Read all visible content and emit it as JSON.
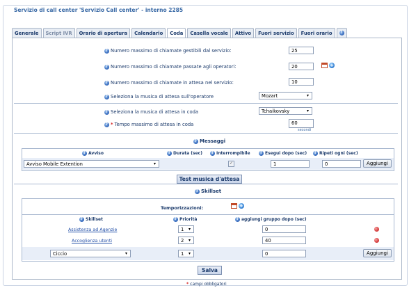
{
  "window": {
    "title": "Servizio di call center 'Servizio Call center' - interno 2285"
  },
  "tabs": [
    {
      "label": "Generale",
      "active": false
    },
    {
      "label": "Script IVR",
      "active": false
    },
    {
      "label": "Orario di apertura",
      "active": false
    },
    {
      "label": "Calendario",
      "active": false
    },
    {
      "label": "Coda",
      "active": true
    },
    {
      "label": "Casella vocale",
      "active": false
    },
    {
      "label": "Attivo",
      "active": false
    },
    {
      "label": "Fuori servizio",
      "active": false
    },
    {
      "label": "Fuori orario",
      "active": false
    }
  ],
  "queue": {
    "max_calls_label": "Numero massimo di chiamate gestibili dal servizio:",
    "max_calls_value": "25",
    "max_operator_calls_label": "Numero massimo di chiamate passate agli operatori:",
    "max_operator_calls_value": "20",
    "max_waiting_label": "Numero massimo di chiamate in attesa nel servizio:",
    "max_waiting_value": "10",
    "operator_music_label": "Seleziona la musica di attesa sull'operatore",
    "operator_music_value": "Mozart",
    "queue_music_label": "Seleziona la musica di attesa in coda",
    "queue_music_value": "Tchaikovsky",
    "max_wait_time_label": "Tempo massimo di attesa in coda",
    "max_wait_time_value": "60",
    "max_wait_time_unit": "secondi"
  },
  "messages": {
    "title": "Messaggi",
    "headers": {
      "avviso": "Avviso",
      "durata": "Durata (sec)",
      "interrompibile": "Interrompibile",
      "esegui_dopo": "Esegui dopo (sec)",
      "ripeti": "Ripeti ogni (sec)"
    },
    "row": {
      "avviso": "Avviso Mobile Extention",
      "interrompibile_checked": true,
      "esegui_dopo": "1",
      "ripeti": "0"
    },
    "add_button": "Aggiungi",
    "test_button": "Test musica d'attesa"
  },
  "skillset": {
    "title": "Skillset",
    "timing_label": "Temporizzazioni:",
    "headers": {
      "skillset": "Skillset",
      "priorita": "Priorità",
      "aggiungi": "aggiungi gruppo dopo (sec)"
    },
    "rows": [
      {
        "name": "Assistenza ad Agenzie",
        "priority": "1",
        "after": "0"
      },
      {
        "name": "Accoglienza utenti",
        "priority": "2",
        "after": "40"
      }
    ],
    "new_row": {
      "name": "Ciccio",
      "priority": "1",
      "after": "0"
    },
    "add_button": "Aggiungi"
  },
  "footer": {
    "save_button": "Salva",
    "required_note": "campi obbligatori",
    "required_mark": "*"
  }
}
